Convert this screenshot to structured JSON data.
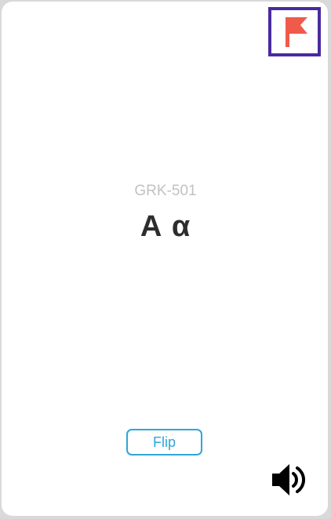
{
  "card": {
    "code": "GRK-501",
    "text": "Α α"
  },
  "actions": {
    "flip_label": "Flip"
  },
  "icons": {
    "flag": "flag-icon",
    "audio": "speaker-icon"
  },
  "colors": {
    "flag": "#f05a4a",
    "flag_border": "#4a2aa0",
    "accent": "#2ea6d8",
    "code_text": "#c2c2c2",
    "card_text": "#2d2d2d"
  }
}
